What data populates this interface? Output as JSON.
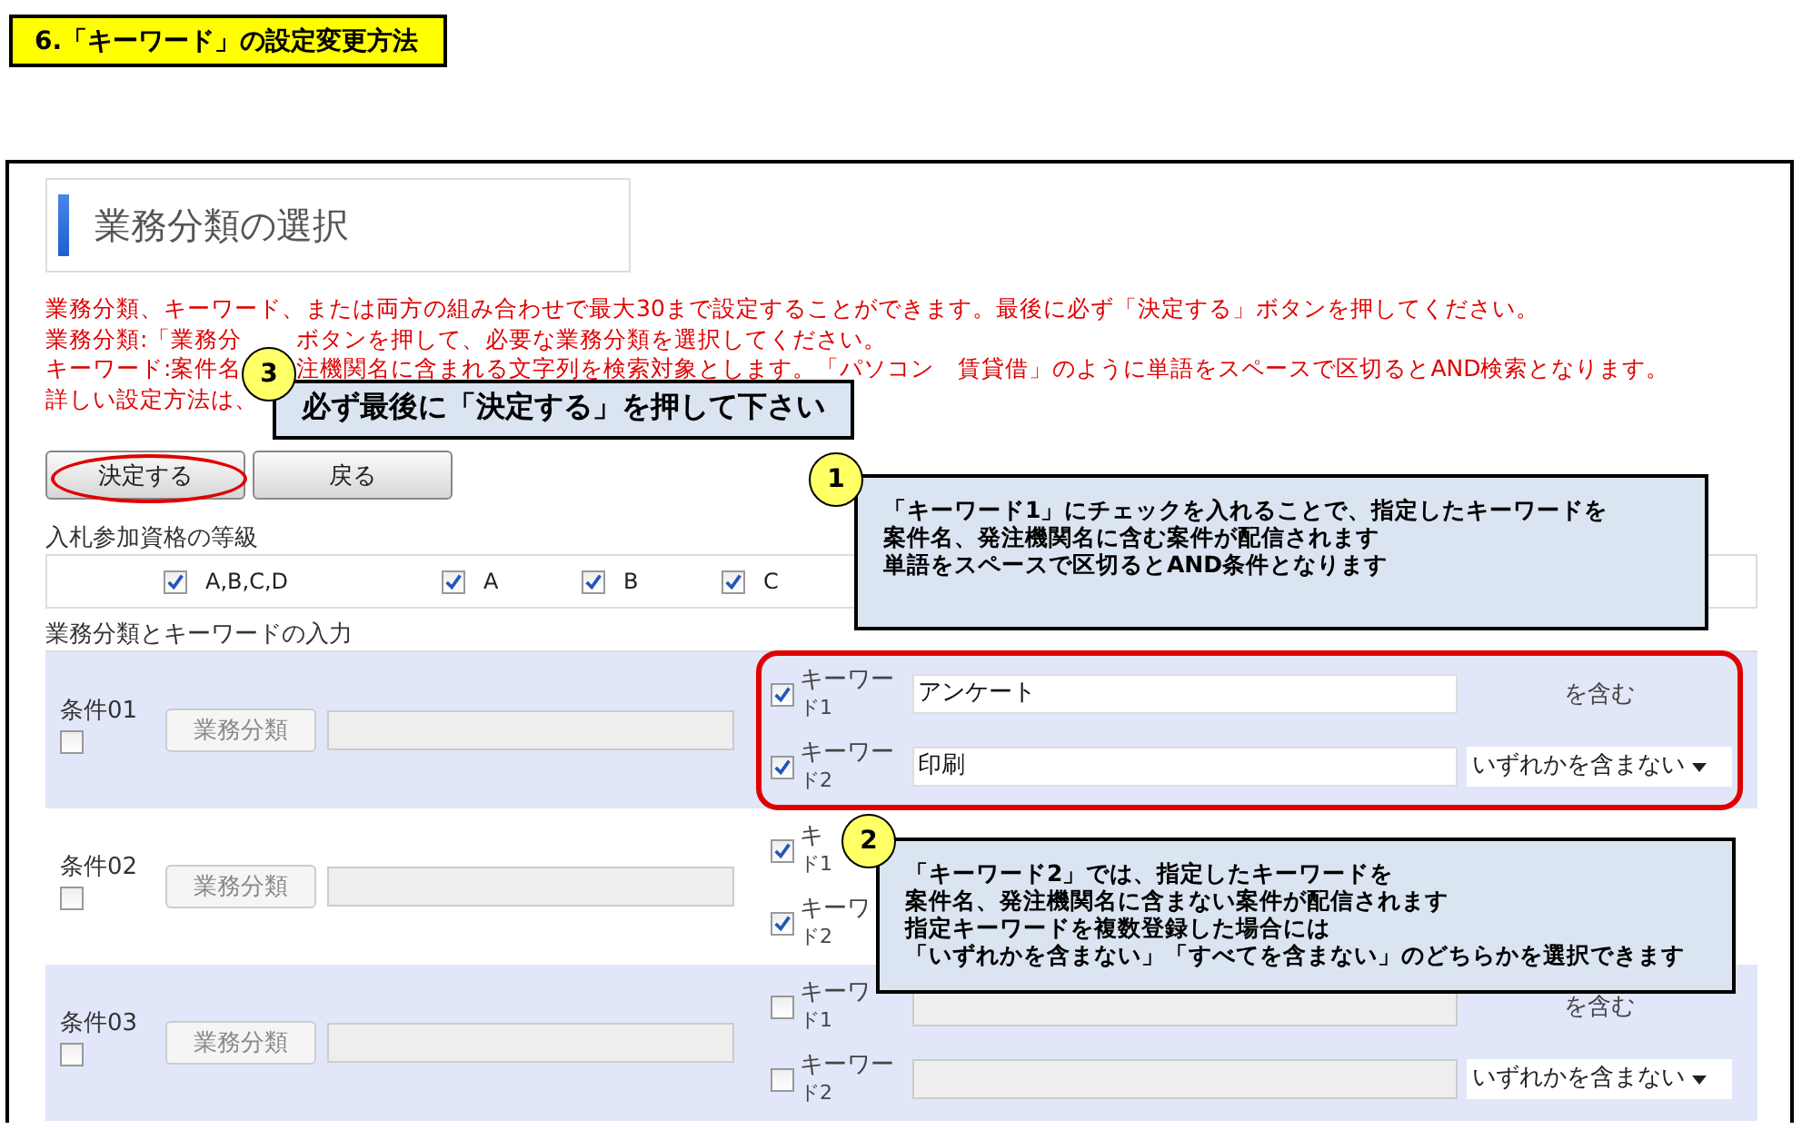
{
  "heading": "6.「キーワード」の設定変更方法",
  "page_title": "業務分類の選択",
  "notice_lines": [
    [
      "業務分類、キーワード、または両方の組み合わせで最大30まで設定することができます。最後に必ず「決定する」ボタンを押してください。"
    ],
    [
      "業務分類:「業務分",
      "ボタンを押して、必要な業務分類を選択してください。"
    ],
    [
      "キーワード:案件名",
      "注機関名に含まれる文字列を検索対象とします。「パソコン　賃貸借」のように単語をスペースで区切るとAND検索となります。"
    ],
    [
      "詳しい設定方法は、"
    ]
  ],
  "buttons": [
    {
      "label": "決定する",
      "highlighted": true
    },
    {
      "label": "戻る",
      "highlighted": false
    }
  ],
  "grade": {
    "legend": "入札参加資格の等級",
    "options": [
      {
        "label": "A,B,C,D",
        "checked": true
      },
      {
        "label": "A",
        "checked": true
      },
      {
        "label": "B",
        "checked": true
      },
      {
        "label": "C",
        "checked": true
      }
    ]
  },
  "conditions": {
    "legend": "業務分類とキーワードの入力",
    "rows": [
      {
        "label": "条件01",
        "checked": false,
        "category_button": "業務分類",
        "highlighted": true,
        "keywords": [
          {
            "line1": "キーワー",
            "line2": "ド1",
            "checked": true,
            "value": "アンケート",
            "kind": "suffix",
            "suffix": "を含む"
          },
          {
            "line1": "キーワー",
            "line2": "ド2",
            "checked": true,
            "value": "印刷",
            "kind": "select",
            "option": "いずれかを含まない"
          }
        ]
      },
      {
        "label": "条件02",
        "checked": false,
        "category_button": "業務分類",
        "highlighted": false,
        "keywords": [
          {
            "line1": "キ",
            "line2": "ド1",
            "checked": true,
            "kind": "covered"
          },
          {
            "line1": "キーワ",
            "line2": "ド2",
            "checked": true,
            "kind": "covered"
          }
        ]
      },
      {
        "label": "条件03",
        "checked": false,
        "category_button": "業務分類",
        "highlighted": false,
        "keywords": [
          {
            "line1": "キーワ",
            "line2": "ド1",
            "checked": false,
            "kind": "suffix",
            "suffix": "を含む"
          },
          {
            "line1": "キーワー",
            "line2": "ド2",
            "checked": false,
            "kind": "select",
            "option": "いずれかを含まない"
          }
        ]
      }
    ]
  },
  "callouts": [
    {
      "number": "3",
      "lines": [
        "必ず最後に「決定する」を押して下さい"
      ]
    },
    {
      "number": "1",
      "lines": [
        "「キーワード1」にチェックを入れることで、指定したキーワードを",
        "案件名、発注機関名に含む案件が配信されます",
        "単語をスペースで区切るとAND条件となります"
      ]
    },
    {
      "number": "2",
      "lines": [
        "「キーワード2」では、指定したキーワードを",
        "案件名、発注機関名に含まない案件が配信されます",
        "指定キーワードを複数登録した場合には",
        "「いずれかを含まない」「すべてを含まない」のどちらかを選択できます"
      ]
    }
  ]
}
